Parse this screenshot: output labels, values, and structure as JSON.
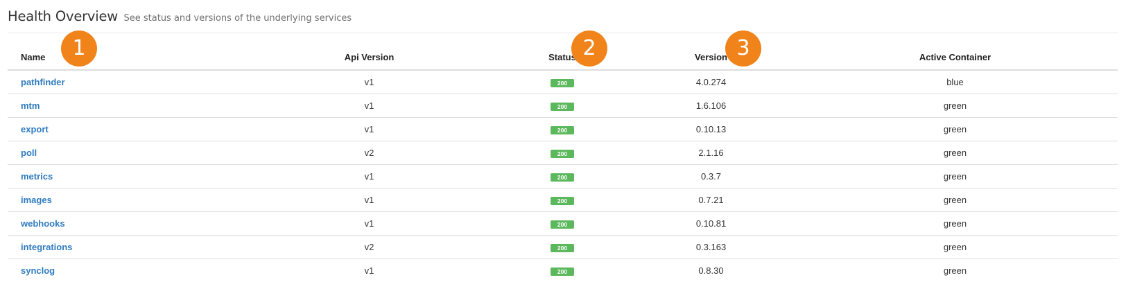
{
  "header": {
    "title": "Health Overview",
    "subtitle": "See status and versions of the underlying services"
  },
  "table": {
    "columns": {
      "name": "Name",
      "api_version": "Api Version",
      "status": "Status",
      "version": "Version",
      "active_container": "Active Container"
    },
    "rows": [
      {
        "name": "pathfinder",
        "api_version": "v1",
        "status": "200",
        "version": "4.0.274",
        "active_container": "blue"
      },
      {
        "name": "mtm",
        "api_version": "v1",
        "status": "200",
        "version": "1.6.106",
        "active_container": "green"
      },
      {
        "name": "export",
        "api_version": "v1",
        "status": "200",
        "version": "0.10.13",
        "active_container": "green"
      },
      {
        "name": "poll",
        "api_version": "v2",
        "status": "200",
        "version": "2.1.16",
        "active_container": "green"
      },
      {
        "name": "metrics",
        "api_version": "v1",
        "status": "200",
        "version": "0.3.7",
        "active_container": "green"
      },
      {
        "name": "images",
        "api_version": "v1",
        "status": "200",
        "version": "0.7.21",
        "active_container": "green"
      },
      {
        "name": "webhooks",
        "api_version": "v1",
        "status": "200",
        "version": "0.10.81",
        "active_container": "green"
      },
      {
        "name": "integrations",
        "api_version": "v2",
        "status": "200",
        "version": "0.3.163",
        "active_container": "green"
      },
      {
        "name": "synclog",
        "api_version": "v1",
        "status": "200",
        "version": "0.8.30",
        "active_container": "green"
      }
    ]
  },
  "markers": [
    "1",
    "2",
    "3"
  ],
  "colors": {
    "link": "#2f7bbf",
    "status_ok": "#5cb85c",
    "marker": "#f0831a"
  }
}
